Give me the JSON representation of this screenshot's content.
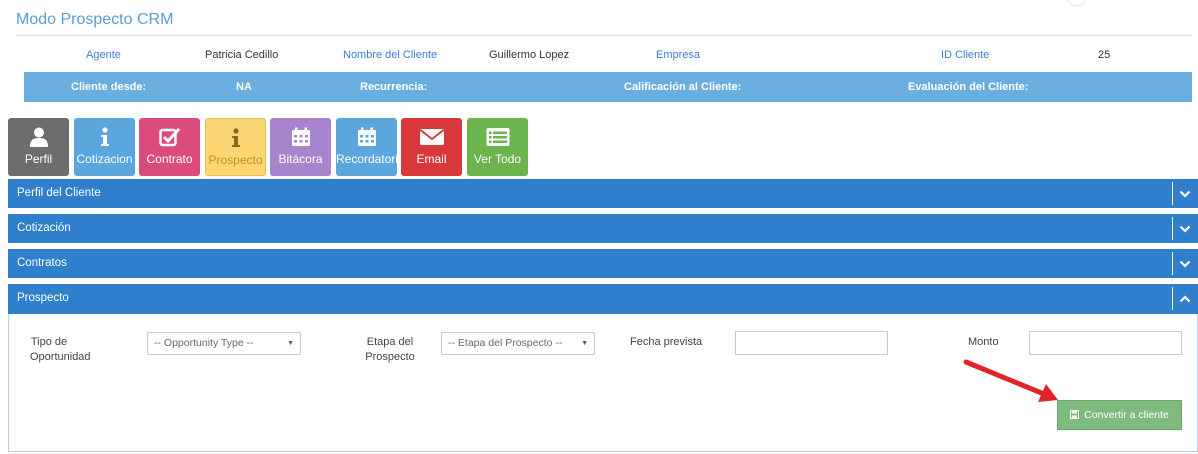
{
  "header": {
    "title": "Modo Prospecto CRM"
  },
  "info": {
    "agent_label": "Agente",
    "agent_value": "Patricia Cedillo",
    "client_name_label": "Nombre del Cliente",
    "client_name_value": "Guillermo Lopez",
    "company_label": "Empresa",
    "company_value": "",
    "client_id_label": "ID Cliente",
    "client_id_value": "25",
    "client_since_label": "Cliente desde:",
    "client_since_value": "NA",
    "recurrence_label": "Recurrencia:",
    "rating_label": "Calificación al Cliente:",
    "evaluation_label": "Evaluación del Cliente:"
  },
  "tiles": [
    {
      "label": "Perfil",
      "icon": "user-icon",
      "color": "#6d6d6d"
    },
    {
      "label": "Cotizacion",
      "icon": "info-icon",
      "color": "#5aa6dd"
    },
    {
      "label": "Contrato",
      "icon": "checkbox-icon",
      "color": "#db4b7e"
    },
    {
      "label": "Prospecto",
      "icon": "info-icon",
      "color": "#fbd673"
    },
    {
      "label": "Bitácora",
      "icon": "calendar-icon",
      "color": "#a685cc"
    },
    {
      "label": "Recordatorio",
      "icon": "calendar-icon",
      "color": "#5aa6dd"
    },
    {
      "label": "Email",
      "icon": "envelope-icon",
      "color": "#d9383a"
    },
    {
      "label": "Ver Todo",
      "icon": "list-icon",
      "color": "#6bb44e"
    }
  ],
  "accordion": [
    {
      "title": "Perfil del Cliente",
      "state": "collapsed"
    },
    {
      "title": "Cotización",
      "state": "collapsed"
    },
    {
      "title": "Contratos",
      "state": "collapsed"
    },
    {
      "title": "Prospecto",
      "state": "expanded"
    }
  ],
  "prospect_form": {
    "opportunity_type_label": "Tipo de Oportunidad",
    "opportunity_type_selected": "-- Opportunity Type --",
    "stage_label": "Etapa del Prospecto",
    "stage_selected": "-- Etapa del Prospecto --",
    "expected_date_label": "Fecha prevista",
    "expected_date_value": "",
    "amount_label": "Monto",
    "amount_value": "",
    "convert_button": "Convertir a cliente"
  },
  "colors": {
    "accordion_bar": "#2f7fcd",
    "info_bar": "#6aaee0",
    "label_blue": "#3b7dd8",
    "convert_button": "#7fba7f",
    "arrow": "#e0242a"
  }
}
